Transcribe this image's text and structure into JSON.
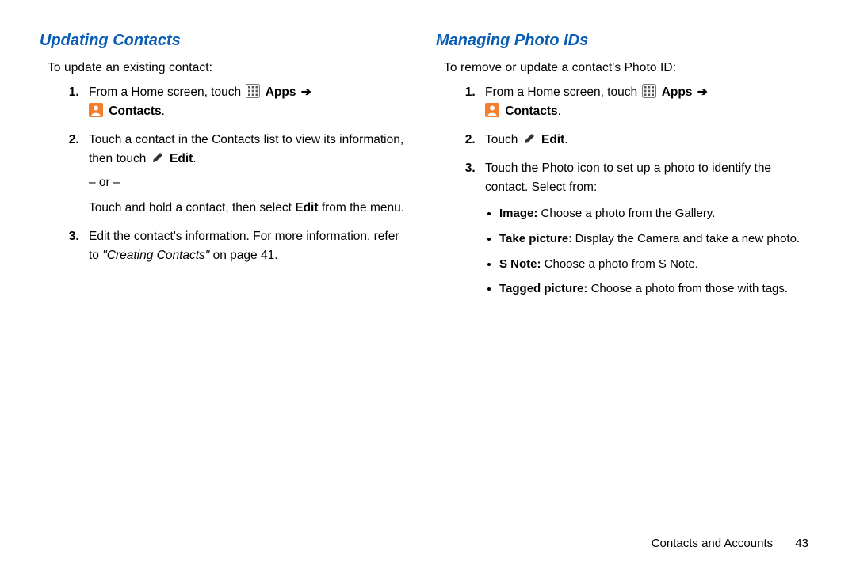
{
  "left": {
    "heading": "Updating Contacts",
    "intro": "To update an existing contact:",
    "step1_a": "From a Home screen, touch ",
    "apps_label": "Apps",
    "contacts_label": "Contacts",
    "period": ".",
    "step2_a": "Touch a contact in the Contacts list to view its information, then touch ",
    "edit_label": "Edit",
    "or": "– or –",
    "step2_b1": "Touch and hold a contact, then select ",
    "step2_b2": " from the menu.",
    "step3_a": "Edit the contact's information. For more information, refer to ",
    "step3_ref": "\"Creating Contacts\"",
    "step3_b": "  on page 41."
  },
  "right": {
    "heading": "Managing Photo IDs",
    "intro": "To remove or update a contact's Photo ID:",
    "step1_a": "From a Home screen, touch ",
    "apps_label": "Apps",
    "contacts_label": "Contacts",
    "period": ".",
    "step2_a": "Touch ",
    "edit_label": "Edit",
    "step3": "Touch the Photo icon to set up a photo to identify the contact. Select from:",
    "bul1_b": "Image:",
    "bul1_t": " Choose a photo from the Gallery.",
    "bul2_b": "Take picture",
    "bul2_t": ": Display the Camera and take a new photo.",
    "bul3_b": "S Note:",
    "bul3_t": " Choose a photo from S Note.",
    "bul4_b": "Tagged picture:",
    "bul4_t": " Choose a photo from those with tags."
  },
  "footer": {
    "section": "Contacts and Accounts",
    "page": "43"
  },
  "glyphs": {
    "arrow": "➔"
  }
}
